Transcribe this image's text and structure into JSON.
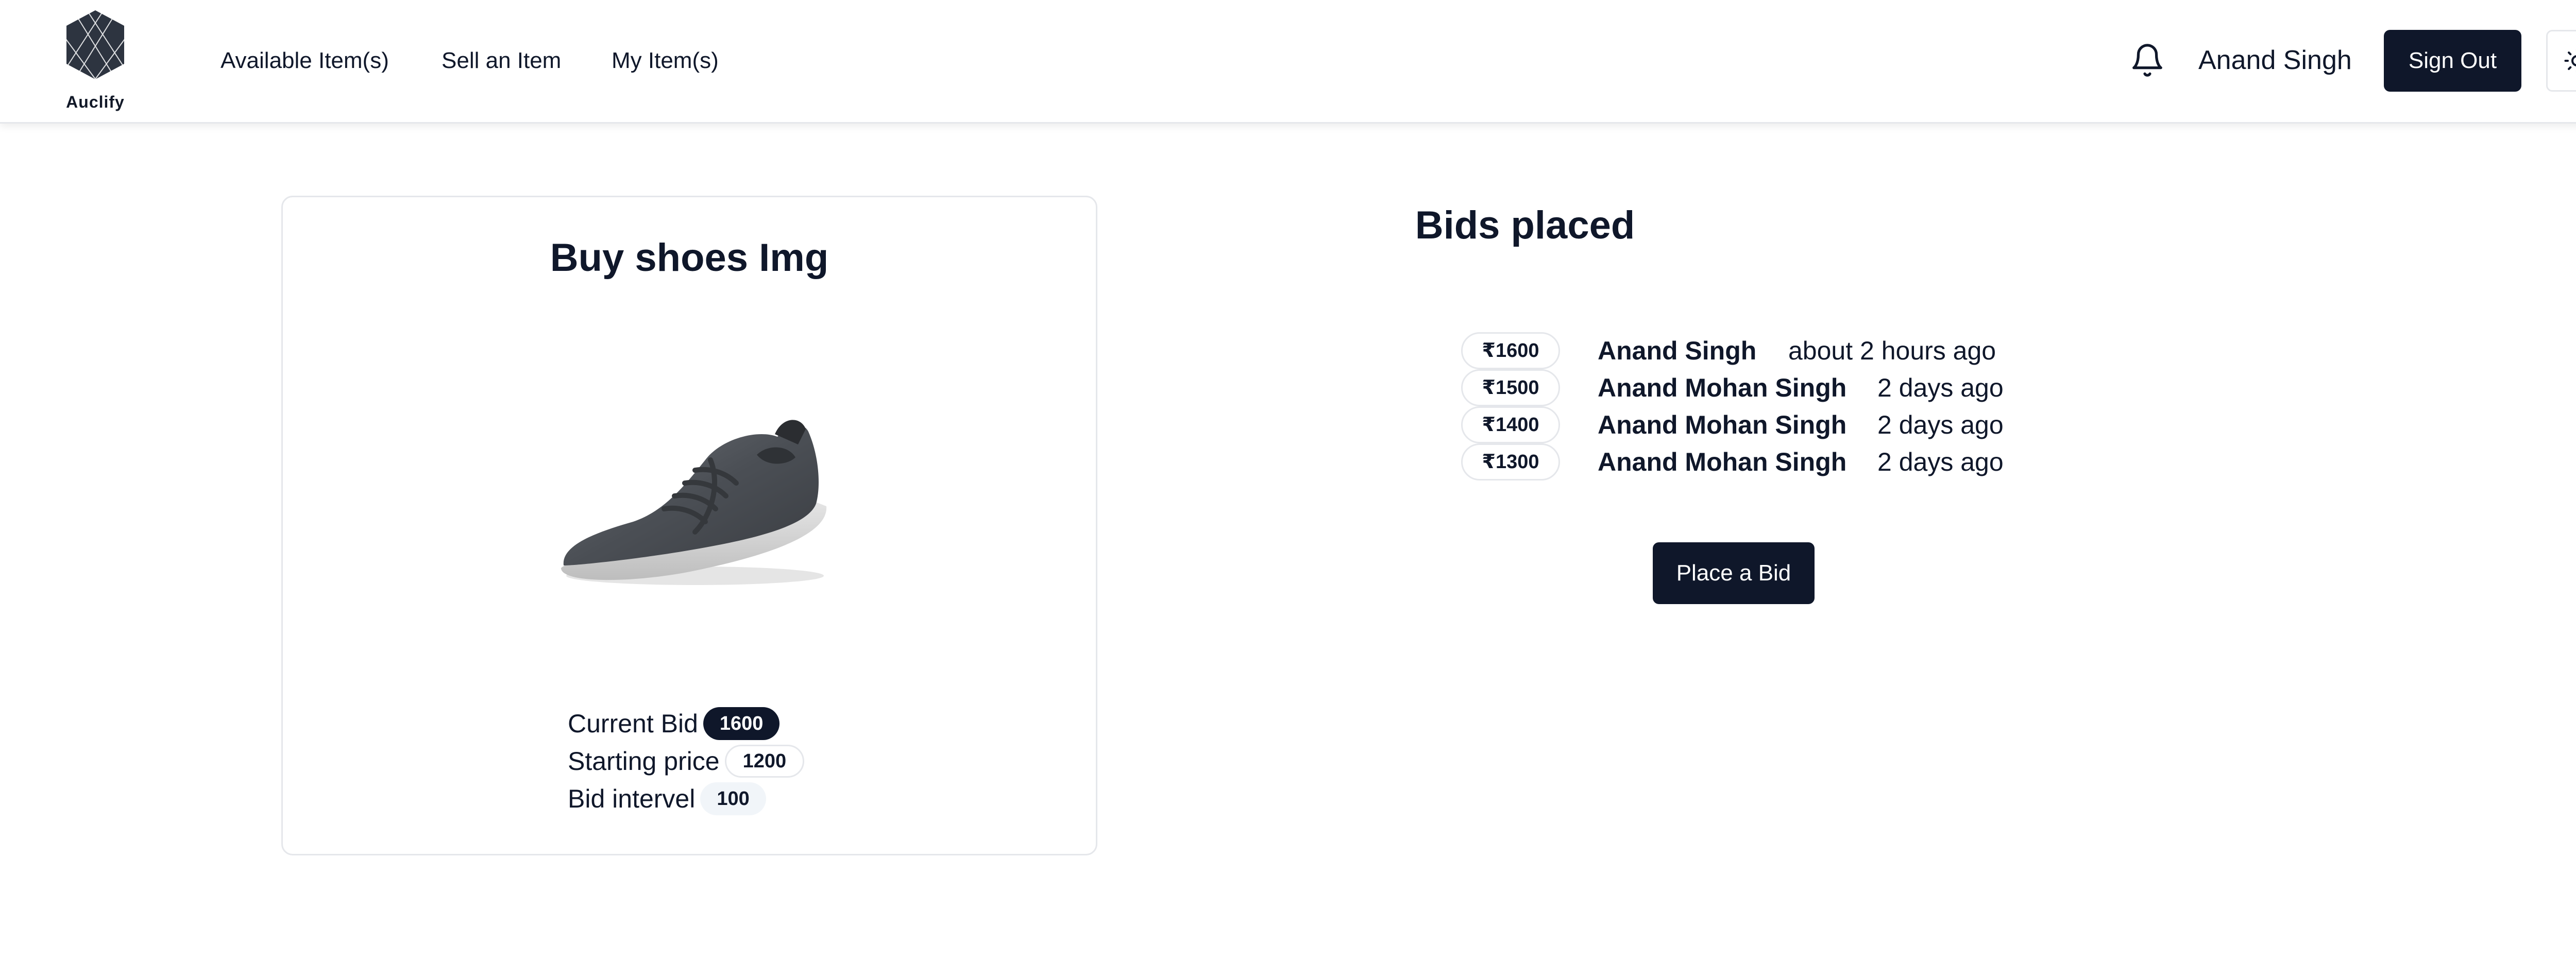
{
  "header": {
    "logo_text": "Auclify",
    "nav": [
      {
        "label": "Available Item(s)"
      },
      {
        "label": "Sell an Item"
      },
      {
        "label": "My Item(s)"
      }
    ],
    "user_name": "Anand Singh",
    "sign_out_label": "Sign Out",
    "icons": {
      "notifications": "bell-icon",
      "theme_toggle": "sun-icon"
    }
  },
  "item": {
    "title": "Buy shoes Img",
    "image": "grey-knit-sneaker",
    "current_bid_label": "Current Bid",
    "current_bid": "1600",
    "starting_price_label": "Starting price",
    "starting_price": "1200",
    "bid_interval_label": "Bid intervel",
    "bid_interval": "100"
  },
  "bids": {
    "title": "Bids placed",
    "rows": [
      {
        "amount": "₹1600",
        "bidder": "Anand Singh",
        "time": "about 2 hours ago"
      },
      {
        "amount": "₹1500",
        "bidder": "Anand Mohan Singh",
        "time": "2 days ago"
      },
      {
        "amount": "₹1400",
        "bidder": "Anand Mohan Singh",
        "time": "2 days ago"
      },
      {
        "amount": "₹1300",
        "bidder": "Anand Mohan Singh",
        "time": "2 days ago"
      }
    ],
    "place_bid_label": "Place a Bid"
  },
  "colors": {
    "primary": "#0f172a",
    "border": "#e5e7eb",
    "muted_pill": "#f1f5f9"
  }
}
